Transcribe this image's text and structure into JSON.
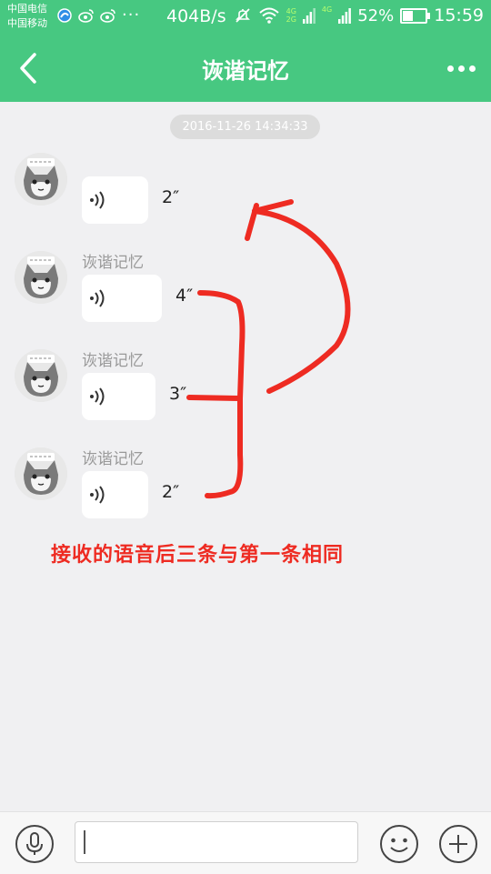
{
  "status_bar": {
    "carrier_1": "中国电信",
    "carrier_2": "中国移动",
    "overflow_dots": "···",
    "net_speed": "404B/s",
    "net_type_top": "4G",
    "net_type_bottom": "2G",
    "net_type_2": "4G",
    "battery_percent": "52%",
    "battery_level": 0.52,
    "time": "15:59"
  },
  "header": {
    "title": "诙谐记忆"
  },
  "chat": {
    "timestamp": "2016-11-26 14:34:33",
    "messages": [
      {
        "sender": "",
        "duration": "2″"
      },
      {
        "sender": "诙谐记忆",
        "duration": "4″"
      },
      {
        "sender": "诙谐记忆",
        "duration": "3″"
      },
      {
        "sender": "诙谐记忆",
        "duration": "2″"
      }
    ]
  },
  "annotation": {
    "text": "接收的语音后三条与第一条相同",
    "color": "#ee2b22"
  },
  "input_bar": {
    "text_value": ""
  },
  "colors": {
    "accent": "#47c881",
    "chat_background": "#f0f0f2",
    "bubble": "#ffffff"
  }
}
